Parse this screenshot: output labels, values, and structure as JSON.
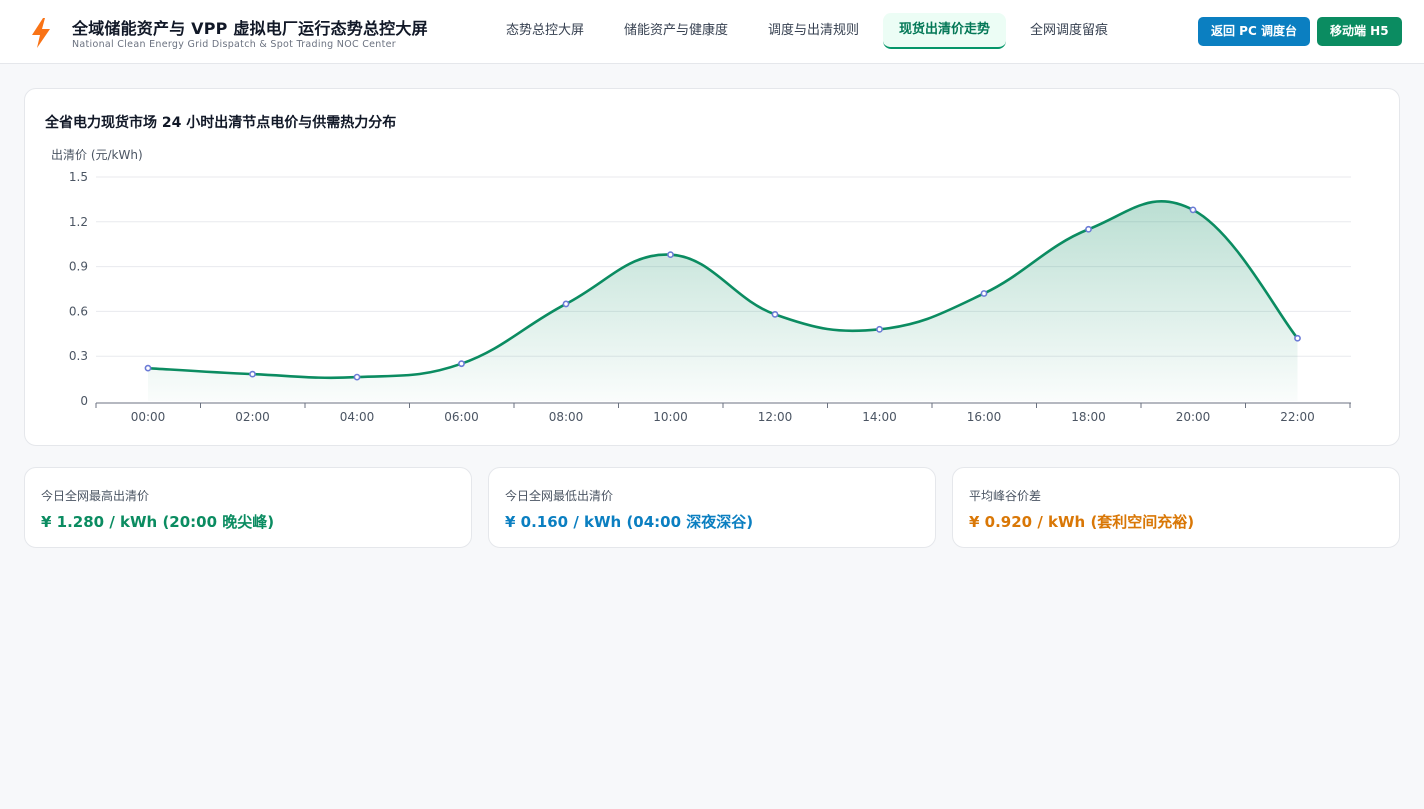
{
  "app": {
    "title": "全域储能资产与 VPP 虚拟电厂运行态势总控大屏",
    "subtitle": "National Clean Energy Grid Dispatch & Spot Trading NOC Center",
    "logo_icon": "lightning-bolt-icon"
  },
  "nav": {
    "tabs": [
      {
        "label": "态势总控大屏",
        "active": false
      },
      {
        "label": "储能资产与健康度",
        "active": false
      },
      {
        "label": "调度与出清规则",
        "active": false
      },
      {
        "label": "现货出清价走势",
        "active": true
      },
      {
        "label": "全网调度留痕",
        "active": false
      }
    ]
  },
  "actions": {
    "pc_label": "返回 PC 调度台",
    "h5_label": "移动端 H5"
  },
  "colors": {
    "accent": "#059669",
    "line": "#0b8c61",
    "point": "#6b7bd6",
    "blue": "#0b7fc1",
    "orange": "#d97706"
  },
  "chart_data": {
    "type": "area",
    "title": "全省电力现货市场 24 小时出清节点电价与供需热力分布",
    "ylabel": "出清价 (元/kWh)",
    "xlabel": "",
    "x": [
      "00:00",
      "02:00",
      "04:00",
      "06:00",
      "08:00",
      "10:00",
      "12:00",
      "14:00",
      "16:00",
      "18:00",
      "20:00",
      "22:00"
    ],
    "series": [
      {
        "values": [
          0.22,
          0.18,
          0.16,
          0.25,
          0.65,
          0.98,
          0.58,
          0.48,
          0.72,
          1.15,
          1.28,
          0.42
        ]
      }
    ],
    "ylim": [
      0,
      1.5
    ],
    "yticks": [
      "0",
      "0.3",
      "0.6",
      "0.9",
      "1.2",
      "1.5"
    ],
    "grid": true,
    "smooth": true
  },
  "stats": [
    {
      "label": "今日全网最高出清价",
      "value": "¥ 1.280 / kWh (20:00 晚尖峰)",
      "color": "#0b8c61"
    },
    {
      "label": "今日全网最低出清价",
      "value": "¥ 0.160 / kWh (04:00 深夜深谷)",
      "color": "#0b7fc1"
    },
    {
      "label": "平均峰谷价差",
      "value": "¥ 0.920 / kWh (套利空间充裕)",
      "color": "#d97706"
    }
  ]
}
